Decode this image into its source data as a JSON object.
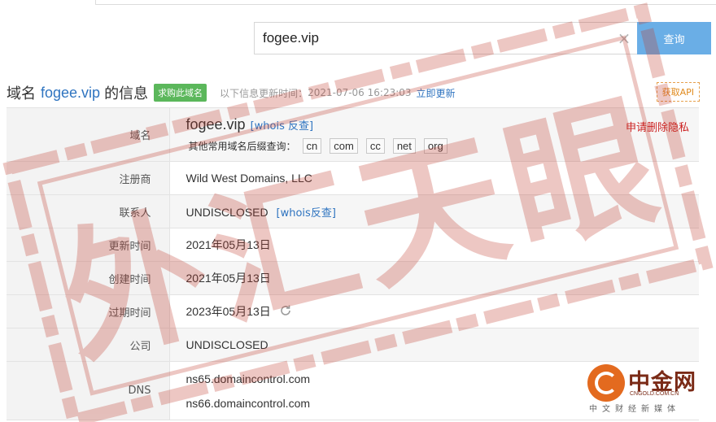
{
  "search": {
    "value": "fogee.vip",
    "button_label": "查询"
  },
  "header": {
    "title_prefix": "域名",
    "domain": "fogee.vip",
    "title_suffix": "的信息",
    "buy_label": "求购此域名",
    "update_label": "以下信息更新时间：",
    "update_time": "2021-07-06 16:23:03",
    "update_link": "立即更新",
    "api_label": "获取API"
  },
  "rows": {
    "domain": {
      "label": "域名",
      "value": "fogee.vip",
      "whois_link": "[whois 反查]",
      "suffix_label": "其他常用域名后缀查询：",
      "suffixes": [
        "cn",
        "com",
        "cc",
        "net",
        "org"
      ],
      "privacy_link": "申请删除隐私"
    },
    "registrar": {
      "label": "注册商",
      "value": "Wild West Domains, LLC"
    },
    "contact": {
      "label": "联系人",
      "value": "UNDISCLOSED",
      "whois_link": "[whois反查]"
    },
    "updated": {
      "label": "更新时间",
      "value": "2021年05月13日"
    },
    "created": {
      "label": "创建时间",
      "value": "2021年05月13日"
    },
    "expires": {
      "label": "过期时间",
      "value": "2023年05月13日"
    },
    "company": {
      "label": "公司",
      "value": "UNDISCLOSED"
    },
    "dns": {
      "label": "DNS",
      "values": [
        "ns65.domaincontrol.com",
        "ns66.domaincontrol.com"
      ]
    }
  },
  "watermark": {
    "text": "外汇天眼",
    "color": "#c0392b"
  },
  "logo": {
    "name": "中金网",
    "url_text": "CNGOLD.COM.CN",
    "tagline": "中文财经新媒体"
  },
  "colors": {
    "link": "#2f74c0",
    "search_button": "#6aaee6",
    "buy_button": "#5bb75b",
    "privacy": "#cc2222",
    "label_bg": "#f3f3f3"
  },
  "icons": {
    "clear": "close-icon",
    "refresh": "refresh-icon"
  }
}
